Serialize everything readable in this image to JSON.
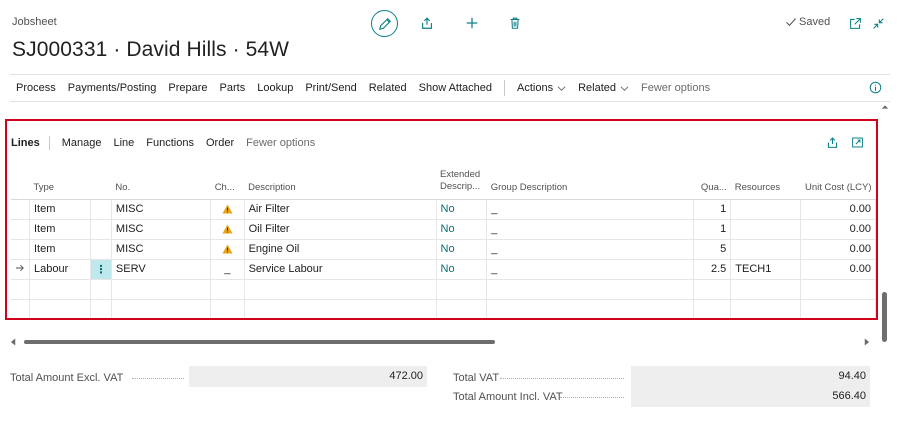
{
  "header": {
    "kind": "Jobsheet",
    "title": "SJ000331 · David Hills · 54W",
    "saved": "Saved"
  },
  "actions": {
    "items": [
      "Process",
      "Payments/Posting",
      "Prepare",
      "Parts",
      "Lookup",
      "Print/Send",
      "Related",
      "Show Attached"
    ],
    "dropdowns": [
      "Actions",
      "Related"
    ],
    "fewer": "Fewer options"
  },
  "lines": {
    "title": "Lines",
    "menu": [
      "Manage",
      "Line",
      "Functions",
      "Order"
    ],
    "fewer": "Fewer options",
    "columns": {
      "type": "Type",
      "no": "No.",
      "ch": "Ch...",
      "description": "Description",
      "extended1": "Extended",
      "extended2": "Descrip...",
      "group": "Group Description",
      "qty": "Qua...",
      "resources": "Resources",
      "unit_cost": "Unit Cost (LCY)"
    },
    "rows": [
      {
        "type": "Item",
        "no": "MISC",
        "ch": "warning",
        "description": "Air Filter",
        "extended": "No",
        "group": "_",
        "qty": "1",
        "resources": "",
        "unit_cost": "0.00"
      },
      {
        "type": "Item",
        "no": "MISC",
        "ch": "warning",
        "description": "Oil Filter",
        "extended": "No",
        "group": "_",
        "qty": "1",
        "resources": "",
        "unit_cost": "0.00"
      },
      {
        "type": "Item",
        "no": "MISC",
        "ch": "warning",
        "description": "Engine Oil",
        "extended": "No",
        "group": "_",
        "qty": "5",
        "resources": "",
        "unit_cost": "0.00"
      },
      {
        "type": "Labour",
        "no": "SERV",
        "ch": "_",
        "description": "Service Labour",
        "extended": "No",
        "group": "_",
        "qty": "2.5",
        "resources": "TECH1",
        "unit_cost": "0.00"
      }
    ],
    "row_menu": "⋮"
  },
  "totals": {
    "excl_label": "Total Amount Excl. VAT",
    "excl_value": "472.00",
    "vat_label": "Total VAT",
    "vat_value": "94.40",
    "incl_label": "Total Amount Incl. VAT",
    "incl_value": "566.40"
  },
  "colors": {
    "accent": "#0a8085",
    "highlight_border": "#d0021b",
    "warning": "#e8a317",
    "link": "#0a6e74"
  },
  "icons": [
    "edit-icon",
    "share-icon",
    "add-icon",
    "delete-icon",
    "check-icon",
    "open-new-window-icon",
    "collapse-icon",
    "info-icon",
    "warning-icon",
    "row-arrow-icon",
    "chevron-down-icon"
  ]
}
